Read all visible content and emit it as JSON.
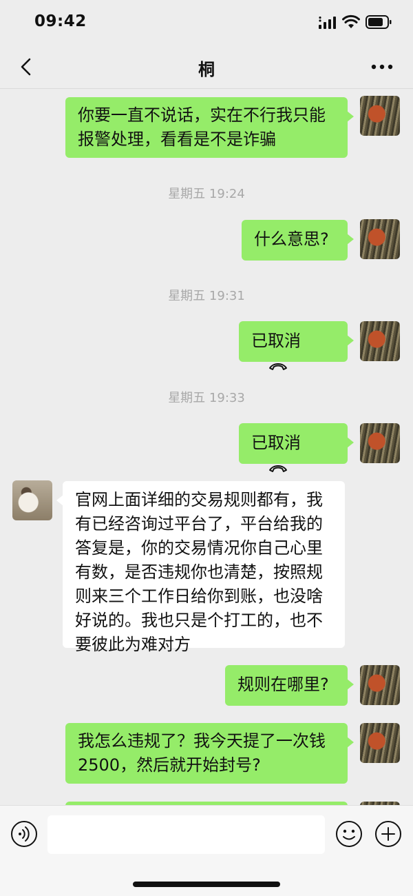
{
  "status_bar": {
    "time": "09:42"
  },
  "header": {
    "title": "桐"
  },
  "messages": {
    "m1_line1": "你要一直不说话，实在不行我只能",
    "m1_line2": "报警处理，看看是不是诈骗",
    "ts1": "星期五 19:24",
    "m2": "什么意思?",
    "ts2": "星期五 19:31",
    "m3": "已取消",
    "ts3": "星期五 19:33",
    "m4": "已取消",
    "m5_line1": "官网上面详细的交易规则都有，我",
    "m5_line2": "有已经咨询过平台了，平台给我的",
    "m5_line3": "答复是，你的交易情况你自己心里",
    "m5_line4": "有数，是否违规你也清楚，按照规",
    "m5_line5": "则来三个工作日给你到账，也没啥",
    "m5_line6": "好说的。我也只是个打工的，也不",
    "m5_line7": "要彼此为难对方",
    "m6": "规则在哪里?",
    "m7_line1": "我怎么违规了？我今天提了一次钱",
    "m7_line2": "2500，然后就开始封号?"
  },
  "input_bar": {
    "placeholder": ""
  },
  "icons": {
    "back": "chevron-left-icon",
    "more": "more-dots-icon",
    "call": "hangup-phone-icon",
    "voice": "voice-icon",
    "emoji": "emoji-icon",
    "plus": "plus-icon"
  },
  "colors": {
    "background": "#ededed",
    "bubble_me": "#95ec69",
    "bubble_other": "#ffffff",
    "timestamp": "#a8a8a8"
  }
}
